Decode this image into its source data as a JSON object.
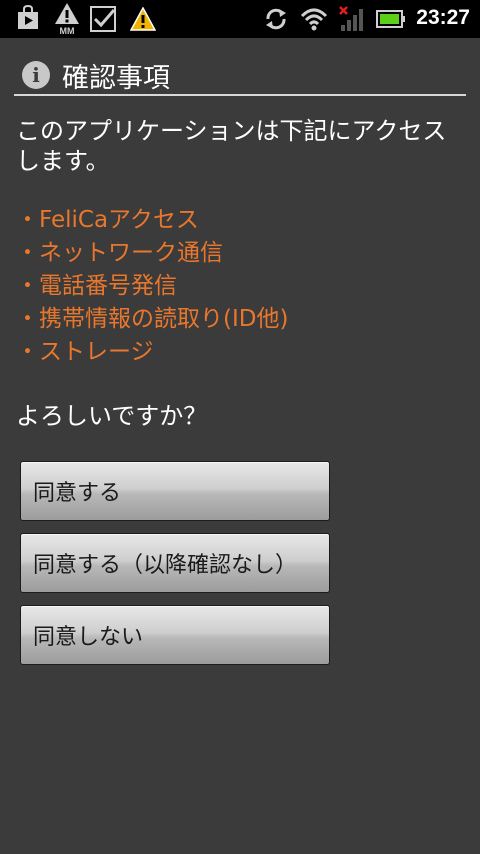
{
  "status_bar": {
    "time": "23:27",
    "left_icons": [
      "shopping-bag-icon",
      "mm-alert-icon",
      "checkbox-icon",
      "warning-icon"
    ],
    "right_icons": [
      "sync-icon",
      "wifi-icon",
      "no-signal-icon",
      "battery-icon"
    ]
  },
  "dialog": {
    "title": "確認事項",
    "message": "このアプリケーションは下記にアクセスします。",
    "permissions": [
      "FeliCaアクセス",
      "ネットワーク通信",
      "電話番号発信",
      "携帯情報の読取り(ID他)",
      "ストレージ"
    ],
    "question": "よろしいですか？",
    "buttons": {
      "agree": "同意する",
      "agree_no_confirm": "同意する（以降確認なし）",
      "disagree": "同意しない"
    }
  },
  "colors": {
    "background": "#3b3b3b",
    "accent_orange": "#e8772e",
    "status_bar": "#000000"
  }
}
